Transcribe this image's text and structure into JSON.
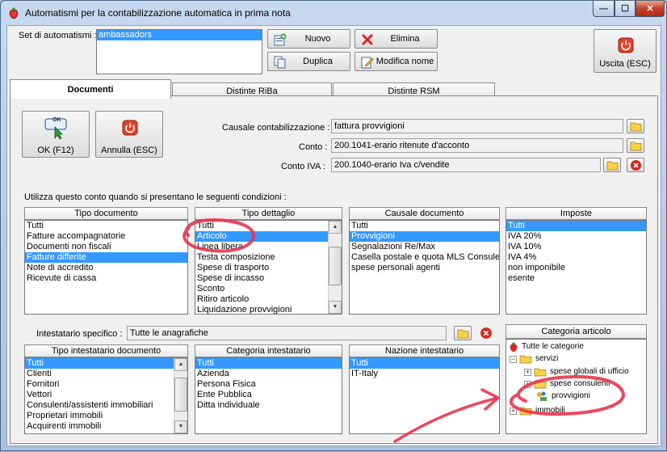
{
  "window": {
    "title": "Automatismi per la contabilizzazione automatica in prima nota",
    "min_label": "—",
    "max_label": "☐",
    "close_label": "✕"
  },
  "top": {
    "set_label": "Set di automatismi :",
    "set_items": [
      "ambassadors"
    ],
    "btn_nuovo": "Nuovo",
    "btn_elimina": "Elimina",
    "btn_duplica": "Duplica",
    "btn_modifica": "Modifica nome",
    "btn_uscita": "Uscita (ESC)"
  },
  "tabs": [
    "Documenti",
    "Distinte RiBa",
    "Distinte RSM"
  ],
  "doc": {
    "btn_ok": "OK (F12)",
    "btn_ok_icon_text": "OK",
    "btn_annulla": "Annulla (ESC)",
    "causale_label": "Causale contabilizzazione :",
    "causale_value": "fattura provvigioni",
    "conto_label": "Conto :",
    "conto_value": "200.1041-erario ritenute d'acconto",
    "conto_iva_label": "Conto IVA :",
    "conto_iva_value": "200.1040-erario Iva c/vendite",
    "conditions_label": "Utilizza questo conto quando si presentano le seguenti condizioni :",
    "tipo_documento": {
      "header": "Tipo documento",
      "items": [
        "Tutti",
        "Fatture accompagnatorie",
        "Documenti non fiscali",
        "Fatture differite",
        "Note di accredito",
        "Ricevute di cassa"
      ],
      "selected": 3
    },
    "tipo_dettaglio": {
      "header": "Tipo dettaglio",
      "items": [
        "Tutti",
        "Articolo",
        "Linea libera",
        "Testa composizione",
        "Spese di trasporto",
        "Spese di incasso",
        "Sconto",
        "Ritiro articolo",
        "Liquidazione provvigioni"
      ],
      "selected": 1
    },
    "causale_documento": {
      "header": "Causale documento",
      "items": [
        "Tutti",
        "Provvigioni",
        "Segnalazioni Re/Max",
        "Casella postale e quota MLS Consulen",
        "spese personali agenti"
      ],
      "selected": 1
    },
    "imposte": {
      "header": "Imposte",
      "items": [
        "Tutti",
        "IVA 20%",
        "IVA 10%",
        "IVA 4%",
        "non imponibile",
        "esente"
      ],
      "selected": 0
    },
    "intestatario_label": "Intestatario specifico :",
    "intestatario_value": "Tutte le anagrafiche",
    "tipo_intestatario": {
      "header": "Tipo intestatario documento",
      "items": [
        "Tutti",
        "Clienti",
        "Fornitori",
        "Vettori",
        "Consulenti/assistenti immobiliari",
        "Proprietari immobili",
        "Acquirenti immobili"
      ],
      "selected": 0
    },
    "categoria_intestatario": {
      "header": "Categoria intestatario",
      "items": [
        "Tutti",
        "Azienda",
        "Persona Fisica",
        "Ente Pubblica",
        "Ditta individuale"
      ],
      "selected": 0
    },
    "nazione_intestatario": {
      "header": "Nazione intestatario",
      "items": [
        "Tutti",
        "IT-Italy"
      ],
      "selected": 0
    },
    "categoria_articolo": {
      "header": "Categoria articolo",
      "root": "Tutte le categorie",
      "servizi": "servizi",
      "spese_globali": "spese globali di ufficio",
      "spese_consulenti": "spese consulenti",
      "provvigioni": "provvigioni",
      "immobili": "immobili"
    }
  },
  "colors": {
    "selection": "#3399ff",
    "annotation": "#e8344e",
    "title_gradient_top": "#c6d9ef"
  }
}
